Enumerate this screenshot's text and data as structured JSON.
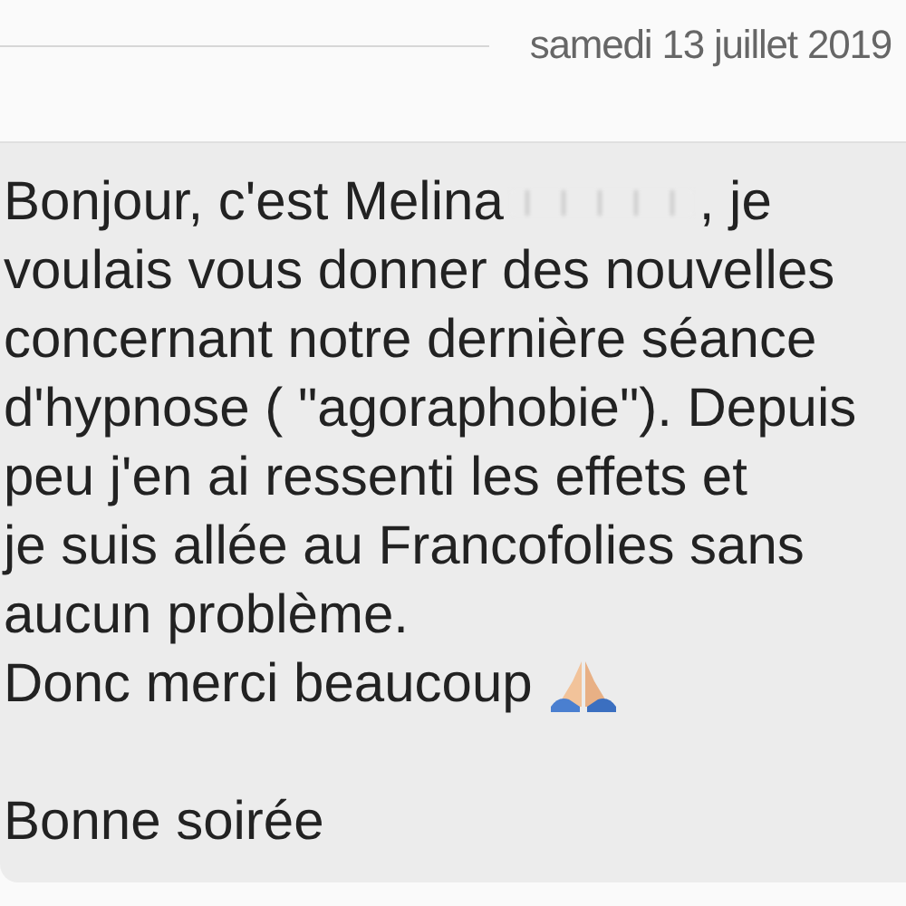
{
  "date_header": "samedi 13 juillet 2019",
  "message": {
    "lines": [
      {
        "text": "Bonjour, c'est Melina",
        "redacted": true,
        "text_after": ", je"
      },
      {
        "text": "voulais vous donner des nouvelles"
      },
      {
        "text": "concernant notre dernière séance"
      },
      {
        "text": "d'hypnose ( \"agoraphobie\"). Depuis"
      },
      {
        "text": "peu j'en ai ressenti les effets et"
      },
      {
        "text": "je suis allée au Francofolies sans"
      },
      {
        "text": "aucun problème."
      },
      {
        "text": "Donc merci beaucoup",
        "emoji": true
      },
      {
        "text": "Bonne soirée",
        "gap_before": true
      }
    ]
  }
}
